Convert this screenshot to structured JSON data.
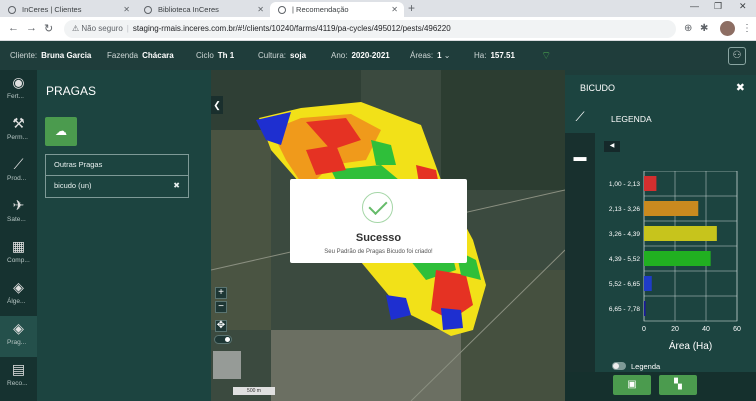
{
  "browser": {
    "tabs": [
      {
        "label": "InCeres | Clientes"
      },
      {
        "label": "Biblioteca InCeres"
      },
      {
        "label": "| Recomendação"
      }
    ],
    "not_secure": "Não seguro",
    "url": "staging-rmais.inceres.com.br/#!/clients/10240/farms/4119/pa-cycles/495012/pests/496220"
  },
  "header": {
    "cliente_label": "Cliente:",
    "cliente": "Bruna Garcia",
    "fazenda_label": "Fazenda",
    "fazenda": "Chácara",
    "ciclo_label": "Ciclo",
    "ciclo": "Th 1",
    "cultura_label": "Cultura:",
    "cultura": "soja",
    "ano_label": "Ano:",
    "ano": "2020-2021",
    "areas_label": "Áreas:",
    "areas": "1",
    "ha_label": "Ha:",
    "ha": "157.51"
  },
  "sidebar": {
    "items": [
      {
        "label": "Fert...",
        "icon": "fertilizer-icon"
      },
      {
        "label": "Perm...",
        "icon": "tractor-icon"
      },
      {
        "label": "Prod...",
        "icon": "chart-line-icon"
      },
      {
        "label": "Sate...",
        "icon": "satellite-icon"
      },
      {
        "label": "Comp...",
        "icon": "composition-icon"
      },
      {
        "label": "Álge...",
        "icon": "layers-icon"
      },
      {
        "label": "Prag...",
        "icon": "layers-icon"
      },
      {
        "label": "Reco...",
        "icon": "recommendation-icon"
      }
    ]
  },
  "pragas": {
    "title": "PRAGAS",
    "items": [
      {
        "label": "Outras Pragas"
      },
      {
        "label": "bicudo (un)"
      }
    ]
  },
  "map": {
    "scale_label": "500 m"
  },
  "modal": {
    "title": "Sucesso",
    "message": "Seu Padrão de Pragas Bicudo foi criado!"
  },
  "right_panel": {
    "title": "BICUDO",
    "legend_title": "LEGENDA",
    "legend_toggle_label": "Legenda"
  },
  "chart_data": {
    "type": "bar",
    "orientation": "horizontal",
    "categories": [
      "1,00 - 2,13",
      "2,13 - 3,26",
      "3,26 - 4,39",
      "4,39 - 5,52",
      "5,52 - 6,65",
      "6,65 - 7,78"
    ],
    "values": [
      8,
      35,
      47,
      43,
      5,
      1
    ],
    "colors": [
      "#d32f2f",
      "#c98a1f",
      "#c7c41c",
      "#21b021",
      "#1f3cc8",
      "#1a1a9e"
    ],
    "xlabel": "Área (Ha)",
    "xticks": [
      0,
      20,
      40,
      60
    ],
    "xlim": [
      0,
      60
    ],
    "grid": true
  }
}
